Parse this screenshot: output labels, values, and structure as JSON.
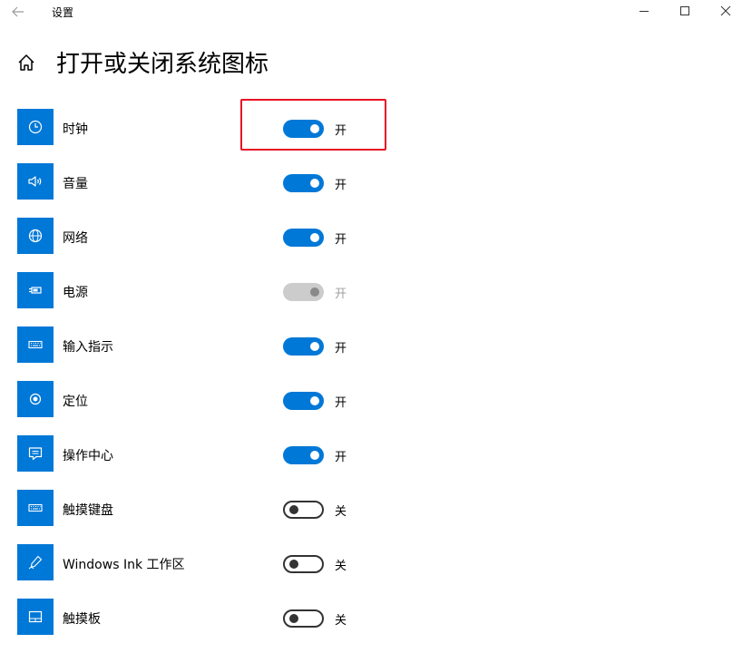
{
  "window": {
    "title": "设置"
  },
  "page": {
    "title": "打开或关闭系统图标"
  },
  "colors": {
    "accent": "#0078d7",
    "highlight": "#e81123"
  },
  "items": [
    {
      "label": "时钟",
      "icon": "clock-icon",
      "state": "on",
      "state_label": "开",
      "enabled": true
    },
    {
      "label": "音量",
      "icon": "volume-icon",
      "state": "on",
      "state_label": "开",
      "enabled": true
    },
    {
      "label": "网络",
      "icon": "globe-icon",
      "state": "on",
      "state_label": "开",
      "enabled": true
    },
    {
      "label": "电源",
      "icon": "battery-icon",
      "state": "on",
      "state_label": "开",
      "enabled": false
    },
    {
      "label": "输入指示",
      "icon": "keyboard-icon",
      "state": "on",
      "state_label": "开",
      "enabled": true
    },
    {
      "label": "定位",
      "icon": "location-icon",
      "state": "on",
      "state_label": "开",
      "enabled": true
    },
    {
      "label": "操作中心",
      "icon": "action-center-icon",
      "state": "on",
      "state_label": "开",
      "enabled": true
    },
    {
      "label": "触摸键盘",
      "icon": "touch-keyboard-icon",
      "state": "off",
      "state_label": "关",
      "enabled": true
    },
    {
      "label": "Windows Ink 工作区",
      "icon": "pen-icon",
      "state": "off",
      "state_label": "关",
      "enabled": true
    },
    {
      "label": "触摸板",
      "icon": "touchpad-icon",
      "state": "off",
      "state_label": "关",
      "enabled": true
    }
  ]
}
